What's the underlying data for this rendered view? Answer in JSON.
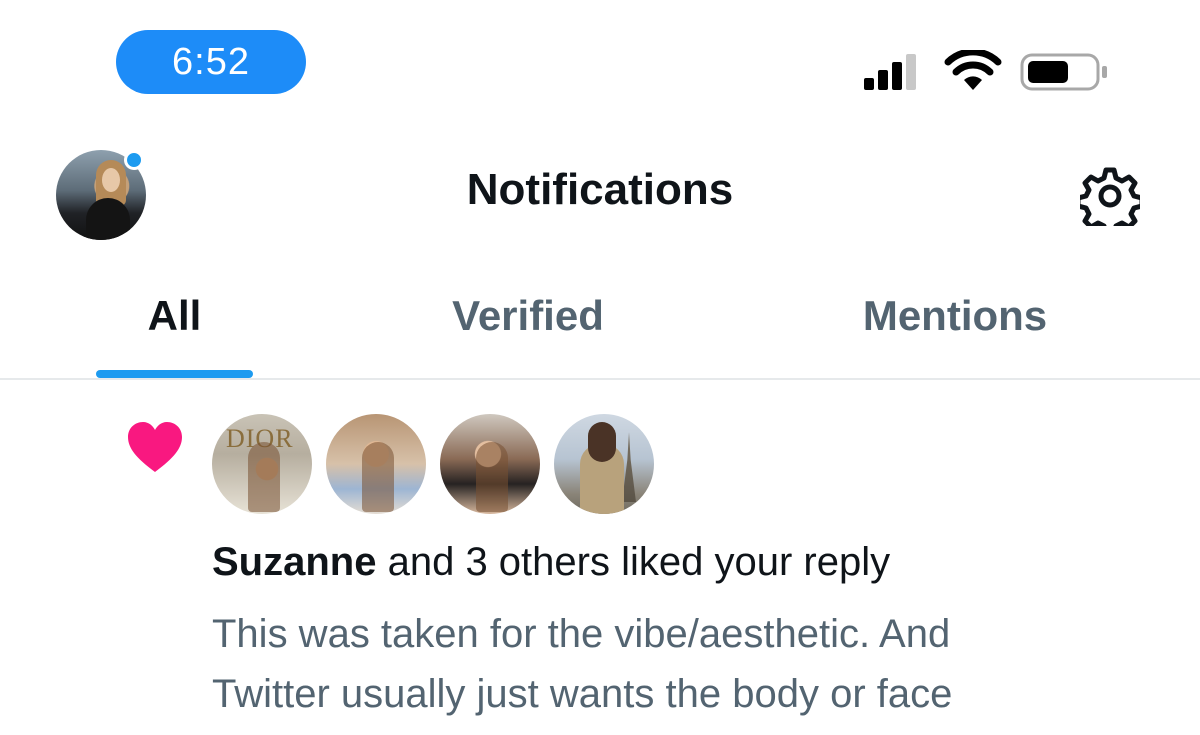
{
  "status_bar": {
    "time": "6:52",
    "accent_color": "#1d8cf8",
    "icons": [
      "cellular-signal-icon",
      "wifi-icon",
      "battery-icon"
    ]
  },
  "header": {
    "title": "Notifications",
    "settings_icon": "gear-icon",
    "unread_dot_color": "#1d9bf0"
  },
  "tabs": [
    {
      "label": "All",
      "active": true
    },
    {
      "label": "Verified",
      "active": false
    },
    {
      "label": "Mentions",
      "active": false
    }
  ],
  "notifications": [
    {
      "type": "like",
      "icon": "heart-icon",
      "icon_color": "#f91880",
      "avatar_count": 4,
      "logo_text": "DIOR",
      "actor": "Suzanne",
      "action": " and 3 others liked your reply",
      "preview_line1": "This was taken for the vibe/aesthetic. And",
      "preview_line2": "Twitter usually just wants the body or face"
    }
  ]
}
